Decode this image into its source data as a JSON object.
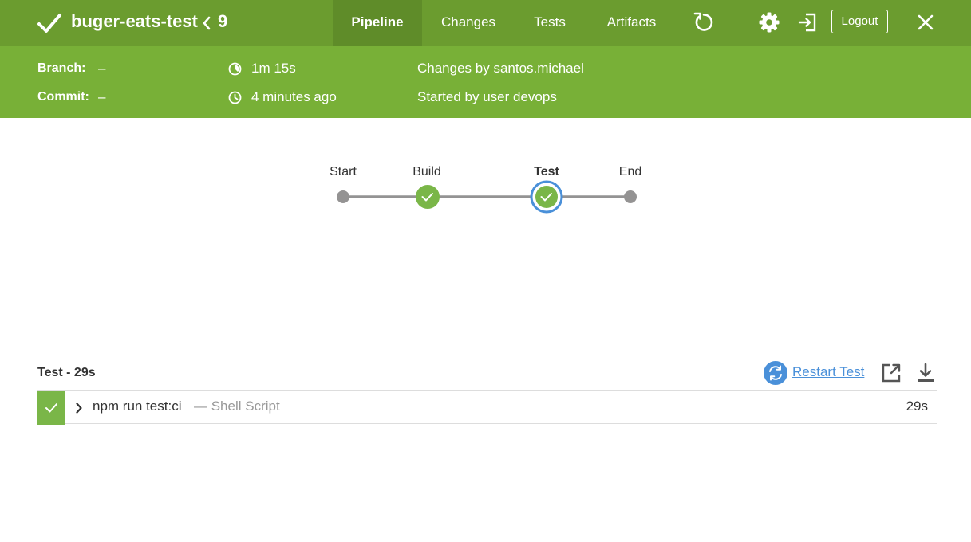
{
  "header": {
    "pipeline_name": "buger-eats-test",
    "run_number": "9",
    "tabs": [
      {
        "label": "Pipeline",
        "active": true
      },
      {
        "label": "Changes",
        "active": false
      },
      {
        "label": "Tests",
        "active": false
      },
      {
        "label": "Artifacts",
        "active": false
      }
    ],
    "logout_label": "Logout",
    "icons": [
      "check-icon",
      "back-chevron-icon",
      "replay-icon",
      "gear-icon",
      "exit-icon",
      "close-icon"
    ]
  },
  "run_info": {
    "branch_label": "Branch:",
    "branch_value": "–",
    "commit_label": "Commit:",
    "commit_value": "–",
    "duration": "1m 15s",
    "started_ago": "4 minutes ago",
    "changes_by": "Changes by santos.michael",
    "started_by": "Started by user devops"
  },
  "graph": {
    "stages": [
      {
        "label": "Start",
        "status": "none",
        "selected": false
      },
      {
        "label": "Build",
        "status": "success",
        "selected": false
      },
      {
        "label": "Test",
        "status": "success",
        "selected": true
      },
      {
        "label": "End",
        "status": "none",
        "selected": false
      }
    ]
  },
  "steps": {
    "title": "Test - 29s",
    "restart_label": "Restart Test",
    "items": [
      {
        "command": "npm run test:ci",
        "type": "— Shell Script",
        "duration": "29s",
        "status": "success"
      }
    ]
  },
  "colors": {
    "topbar": "#6b9c2f",
    "infobar": "#78b037",
    "success": "#7ab648",
    "selected_ring": "#4a90d9",
    "link": "#4a90d9"
  }
}
